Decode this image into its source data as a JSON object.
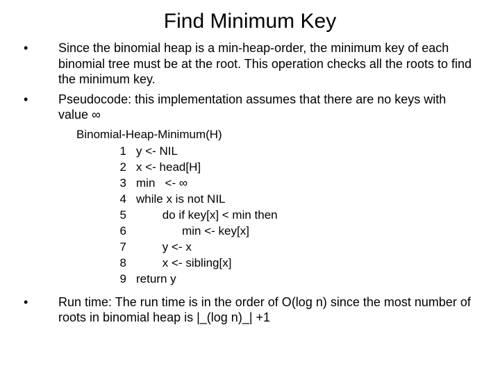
{
  "title": "Find Minimum Key",
  "bullets": {
    "b1": "Since the binomial heap is a min-heap-order, the minimum key of each binomial tree must be at the root. This operation checks all the roots to find the minimum key.",
    "b2": "Pseudocode: this implementation assumes that there are no keys with value ∞",
    "b3": "Run time: The run time is in the order of O(log n) since the most number of roots in binomial heap is |_(log n)_| +1"
  },
  "code": {
    "header": "Binomial-Heap-Minimum(H)",
    "lines": [
      {
        "n": "1",
        "c": "y <- NIL"
      },
      {
        "n": "2",
        "c": "x <- head[H]"
      },
      {
        "n": "3",
        "c": "min   <- ∞"
      },
      {
        "n": "4",
        "c": "while x is not NIL"
      },
      {
        "n": "5",
        "c": "        do if key[x] < min then"
      },
      {
        "n": "6",
        "c": "              min <- key[x]"
      },
      {
        "n": "7",
        "c": "        y <- x"
      },
      {
        "n": "8",
        "c": "        x <- sibling[x]"
      },
      {
        "n": "9",
        "c": "return y"
      }
    ]
  }
}
